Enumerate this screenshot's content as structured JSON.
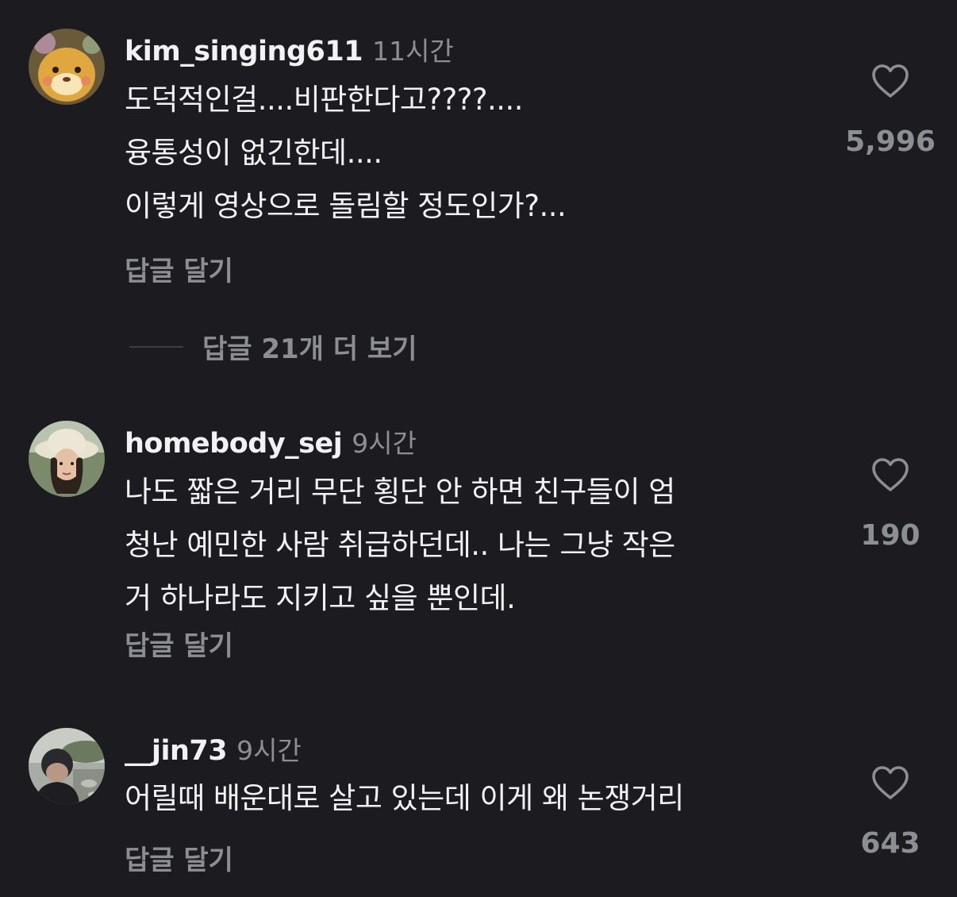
{
  "comments": [
    {
      "username": "kim_singing611",
      "time": "11시간",
      "lines": [
        "도덕적인걸....비판한다고????....",
        "융통성이 없긴한데....",
        "이렇게 영상으로 돌림할 정도인가?..."
      ],
      "reply_label": "답글 달기",
      "likes": "5,996"
    },
    {
      "username": "homebody_sej",
      "time": "9시간",
      "lines": [
        "나도 짧은 거리 무단 횡단 안 하면 친구들이 엄",
        "청난 예민한 사람 취급하던데.. 나는 그냥 작은",
        "거 하나라도 지키고 싶을 뿐인데."
      ],
      "reply_label": "답글 달기",
      "likes": "190"
    },
    {
      "username": "__jin73",
      "time": "9시간",
      "lines": [
        "어릴때 배운대로 살고 있는데 이게 왜 논쟁거리"
      ],
      "reply_label": "답글 달기",
      "likes": "643"
    }
  ],
  "more_replies": "답글 21개 더 보기",
  "icons": {
    "like": "heart-outline-icon"
  },
  "colors": {
    "background": "#1c1c20",
    "primary_text": "#f2f2f4",
    "secondary_text": "#8d8d94"
  }
}
